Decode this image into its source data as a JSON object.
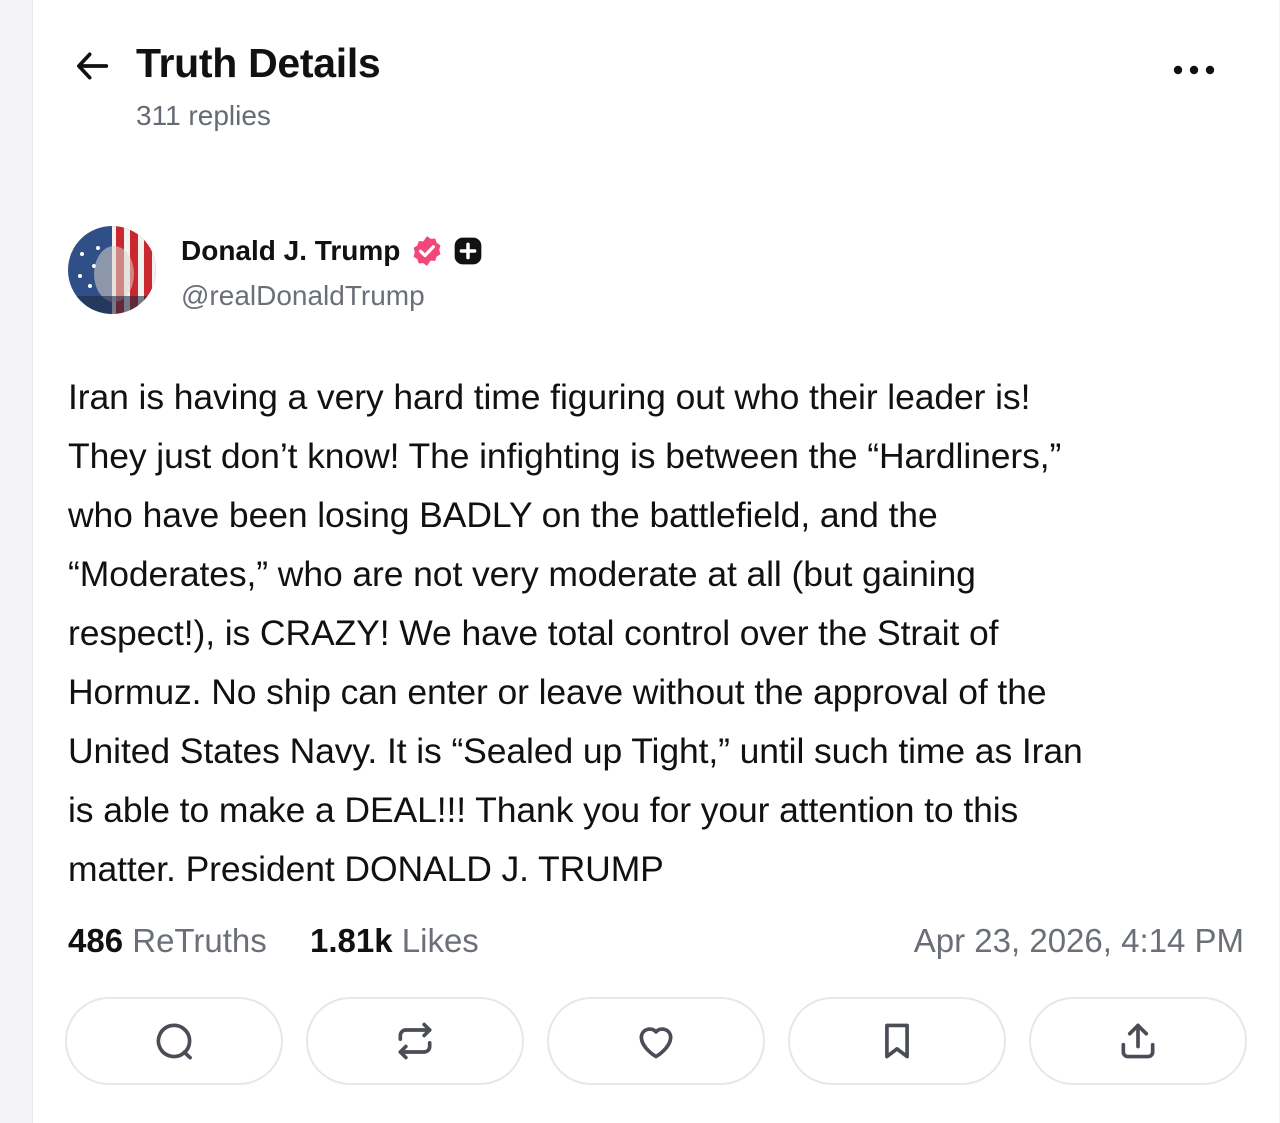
{
  "header": {
    "title": "Truth Details",
    "replies": "311 replies",
    "back_icon": "arrow-left-icon",
    "more_icon": "more-horizontal-icon"
  },
  "author": {
    "name": "Donald J. Trump",
    "handle": "@realDonaldTrump",
    "verified_badge_color": "#f1477a",
    "plus_badge_color": "#111111"
  },
  "post": {
    "text": "Iran is having a very hard time figuring out who their leader is!\nThey just don’t know! The infighting is between the “Hardliners,”\nwho have been losing BADLY on the battlefield, and the\n“Moderates,” who are not very moderate at all (but gaining\nrespect!), is CRAZY! We have total control over the Strait of\nHormuz. No ship can enter or leave without the approval of the\nUnited States Navy. It is “Sealed up Tight,” until such time as Iran\nis able to make a DEAL!!! Thank you for your attention to this\nmatter. President DONALD J. TRUMP"
  },
  "stats": {
    "retruths_count": "486",
    "retruths_label": "ReTruths",
    "likes_count": "1.81k",
    "likes_label": "Likes",
    "timestamp": "Apr 23, 2026, 4:14 PM"
  },
  "actions": [
    {
      "name": "reply",
      "icon": "comment-icon"
    },
    {
      "name": "retruth",
      "icon": "repost-icon"
    },
    {
      "name": "like",
      "icon": "heart-icon"
    },
    {
      "name": "bookmark",
      "icon": "bookmark-icon"
    },
    {
      "name": "share",
      "icon": "share-icon"
    }
  ]
}
